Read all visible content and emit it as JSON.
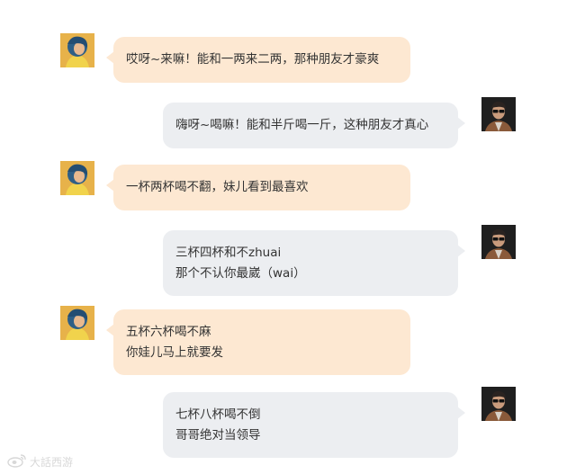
{
  "messages": [
    {
      "side": "left",
      "lines": [
        "哎呀~来嘛！能和一两来二两，那种朋友才豪爽"
      ]
    },
    {
      "side": "right",
      "lines": [
        "嗨呀~喝嘛！能和半斤喝一斤，这种朋友才真心"
      ]
    },
    {
      "side": "left",
      "lines": [
        "一杯两杯喝不翻，妹儿看到最喜欢"
      ]
    },
    {
      "side": "right",
      "lines": [
        "三杯四杯和不zhuai",
        "那个不认你最崴（wai）"
      ]
    },
    {
      "side": "left",
      "lines": [
        "五杯六杯喝不麻",
        "你娃儿马上就要发"
      ]
    },
    {
      "side": "right",
      "lines": [
        "七杯八杯喝不倒",
        "哥哥绝对当领导"
      ]
    }
  ],
  "watermark": {
    "text": "大話西游"
  },
  "colors": {
    "left_bubble": "#fde8d2",
    "right_bubble": "#eceef1"
  }
}
